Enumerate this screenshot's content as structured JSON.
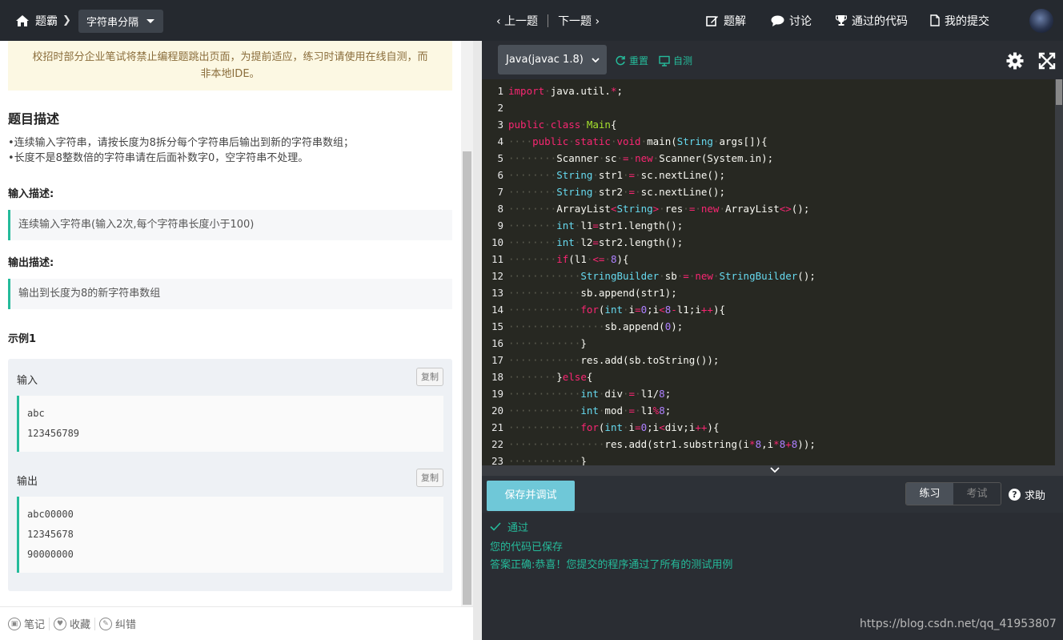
{
  "topbar": {
    "home_label": "题霸",
    "problem_title": "字符串分隔",
    "prev": "上一题",
    "next": "下一题",
    "menu": [
      {
        "icon": "edit-icon",
        "label": "题解"
      },
      {
        "icon": "chat-icon",
        "label": "讨论"
      },
      {
        "icon": "trophy-icon",
        "label": "通过的代码"
      },
      {
        "icon": "file-icon",
        "label": "我的提交"
      }
    ]
  },
  "left": {
    "notice_line1": "校招时部分企业笔试将禁止编程题跳出页面，为提前适应，练习时请使用在线自测，而",
    "notice_line2": "非本地IDE。",
    "desc_heading": "题目描述",
    "desc_line1": "•连续输入字符串，请按长度为8拆分每个字符串后输出到新的字符串数组；",
    "desc_line2": "•长度不是8整数倍的字符串请在后面补数字0，空字符串不处理。",
    "input_heading": "输入描述:",
    "input_desc": "连续输入字符串(输入2次,每个字符串长度小于100)",
    "output_heading": "输出描述:",
    "output_desc": "输出到长度为8的新字符串数组",
    "example_heading": "示例1",
    "example": {
      "input_label": "输入",
      "copy_label": "复制",
      "input_lines": [
        "abc",
        "123456789"
      ],
      "output_label": "输出",
      "output_lines": [
        "abc00000",
        "12345678",
        "90000000"
      ]
    }
  },
  "bottom_left": {
    "note": "笔记",
    "collect": "收藏",
    "report": "纠错"
  },
  "editor": {
    "language": "Java(javac 1.8)",
    "reset": "重置",
    "selftest": "自测",
    "lines": [
      "import java.util.*;",
      "",
      "public class Main{",
      "    public static void main(String args[]){",
      "        Scanner sc = new Scanner(System.in);",
      "        String str1 = sc.nextLine();",
      "        String str2 = sc.nextLine();",
      "        ArrayList<String> res = new ArrayList<>();",
      "        int l1=str1.length();",
      "        int l2=str2.length();",
      "        if(l1 <= 8){",
      "            StringBuilder sb = new StringBuilder();",
      "            sb.append(str1);",
      "            for(int i=0;i<8-l1;i++){",
      "                sb.append(0);",
      "            }",
      "            res.add(sb.toString());",
      "        }else{",
      "            int div = l1/8;",
      "            int mod = l1%8;",
      "            for(int i=0;i<div;i++){",
      "                res.add(str1.substring(i*8,i*8+8));",
      "            }"
    ]
  },
  "console": {
    "save_button": "保存并调试",
    "mode_practice": "练习",
    "mode_exam": "考试",
    "help": "求助",
    "status": "通过",
    "msg1": "您的代码已保存",
    "msg2": "答案正确:恭喜！您提交的程序通过了所有的测试用例"
  },
  "watermark": "https://blog.csdn.net/qq_41953807",
  "colors": {
    "accent": "#25bb9b",
    "topbar_bg": "#25292f",
    "editor_bg": "#272822",
    "notice_bg": "#fcf8e3"
  }
}
